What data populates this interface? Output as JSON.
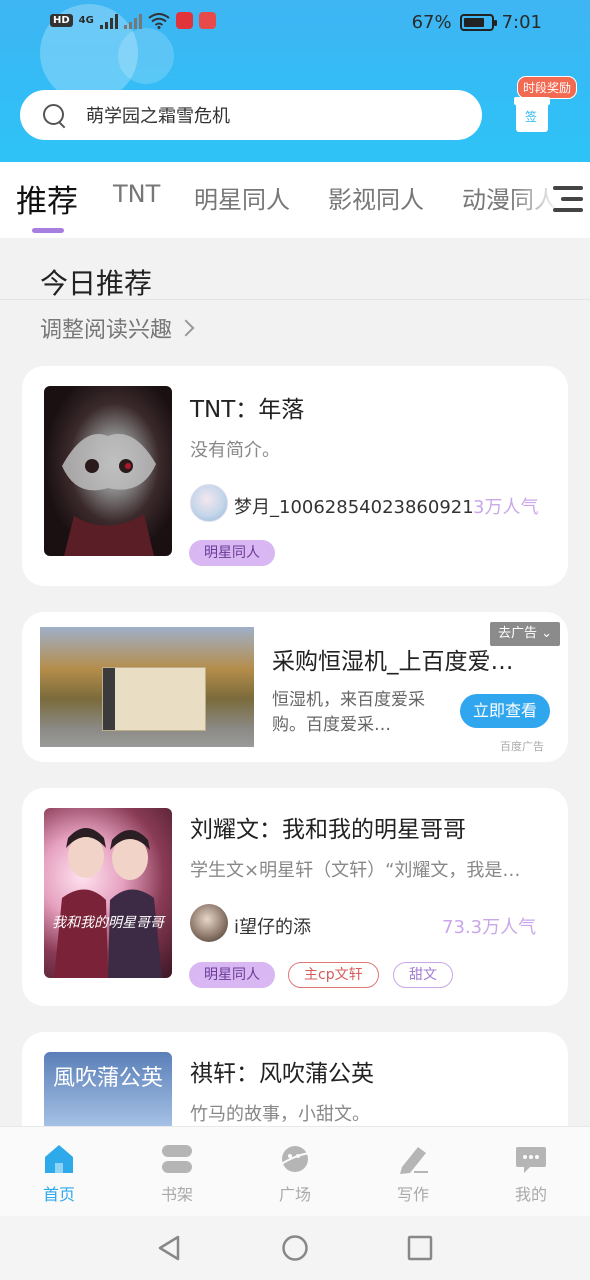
{
  "status_bar": {
    "battery": "67%",
    "time": "7:01",
    "network": "4G",
    "hd": "HD"
  },
  "search": {
    "placeholder": "萌学园之霜雪危机"
  },
  "reward": {
    "badge": "时段奖励",
    "sign": "签"
  },
  "tabs": [
    {
      "label": "推荐",
      "active": true
    },
    {
      "label": "TNT"
    },
    {
      "label": "明星同人"
    },
    {
      "label": "影视同人"
    },
    {
      "label": "动漫同人"
    }
  ],
  "section": {
    "title": "今日推荐",
    "adjust_link": "调整阅读兴趣"
  },
  "books": [
    {
      "title": "TNT：年落",
      "desc": "没有简介。",
      "author": "梦月_10062854023860921",
      "popularity": "3万人气",
      "tags": [
        "明星同人"
      ]
    },
    {
      "title": "刘耀文：我和我的明星哥哥",
      "desc": "学生文×明星轩（文轩）“刘耀文，我是…",
      "author": "i望仔的添",
      "popularity": "73.3万人气",
      "cover_text": "我和我的明星哥哥",
      "tags": [
        "明星同人",
        "主cp文轩",
        "甜文"
      ]
    },
    {
      "title": "祺轩：风吹蒲公英",
      "desc": "竹马的故事，小甜文。",
      "cover_text": "風吹蒲公英"
    }
  ],
  "ad": {
    "title": "采购恒湿机_上百度爱…",
    "desc": "恒湿机，来百度爱采购。百度爱采…",
    "cta": "立即查看",
    "close_label": "去广告",
    "source": "百度广告"
  },
  "bottom_nav": [
    {
      "label": "首页",
      "icon": "home-icon",
      "active": true
    },
    {
      "label": "书架",
      "icon": "bookshelf-icon"
    },
    {
      "label": "广场",
      "icon": "planet-icon"
    },
    {
      "label": "写作",
      "icon": "pen-icon"
    },
    {
      "label": "我的",
      "icon": "chat-bubble-icon"
    }
  ],
  "colors": {
    "accent_blue": "#2ea9ea",
    "accent_purple": "#a57ee0",
    "header_blue": "#3fb5f3"
  }
}
